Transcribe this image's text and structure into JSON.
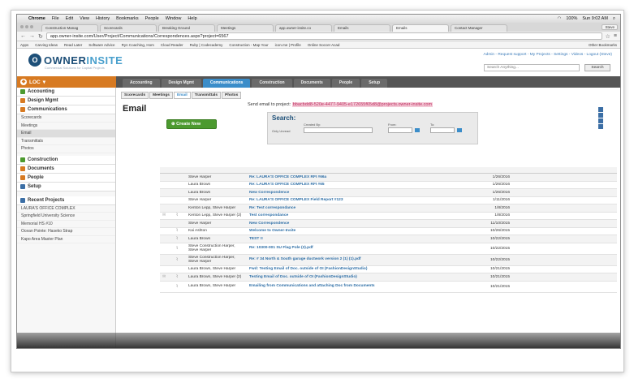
{
  "menubar": {
    "app": "Chrome",
    "items": [
      "File",
      "Edit",
      "View",
      "History",
      "Bookmarks",
      "People",
      "Window",
      "Help"
    ],
    "battery": "100%",
    "clock": "Sun 9:02 AM"
  },
  "tabs": [
    "Construction Manag",
    "Scorecards",
    "Breaking Ground",
    "Meetings",
    "app.owner-insite.co",
    "Emails",
    "Emails",
    "Contact Manager"
  ],
  "browser_user": "Steve",
  "url": "app.owner-insite.com/User/Project/Communications/Correspondences.aspx?project=6567",
  "bookmarks": [
    "Apps",
    "Carving Ideas",
    "Read Later",
    "Software Advice",
    "Ryn Coaching, Hom",
    "Cloud Reader",
    "Ruby | Codecademy",
    "Construction - Map Your",
    "icon.me | Profile",
    "Online Soccer Acad",
    "Other Bookmarks"
  ],
  "logo": {
    "mark": "O",
    "part1": "OWNER",
    "part2": "INSITE",
    "tagline": "Commercial Solutions for Capital Projects"
  },
  "toplinks": "Admin - Request support - My Projects - Settings - Videos - Logout (Steve)",
  "search_placeholder": "Search Anything...",
  "search_button": "Search",
  "loc": "LOC",
  "navtabs": [
    "Accounting",
    "Design Mgmt",
    "Communications",
    "Construction",
    "Documents",
    "People",
    "Setup"
  ],
  "sidebar": {
    "accounting": "Accounting",
    "design": "Design Mgmt",
    "communications": "Communications",
    "comm_items": [
      "Scorecards",
      "Meetings",
      "Email",
      "Transmittals",
      "Photos"
    ],
    "construction": "Construction",
    "documents": "Documents",
    "people": "People",
    "setup": "Setup",
    "recent": "Recent Projects",
    "recent_items": [
      "LAURA'S OFFICE COMPLEX",
      "Springfield University Science",
      "Memorial HS #10",
      "Ocean Pointe: Haseko Strap",
      "Kapo Area Master Plan"
    ]
  },
  "subtabs": [
    "Scorecards",
    "Meetings",
    "Email",
    "Transmittals",
    "Photos"
  ],
  "page_title": "Email",
  "send_email_label": "Send email to project:",
  "send_email_address": "bbacbdd8-520e-4477-9405-e172655f65d8@projects.owner-insite.com",
  "create_button": "Create New",
  "search_panel": {
    "title": "Search:",
    "only_unread": "Only Unread",
    "created_by": "Created By:",
    "from": "From:",
    "to": "To:"
  },
  "rows": [
    {
      "from": "Steve Harper",
      "subject": "Re: LAURA'S OFFICE COMPLEX RFI #66a",
      "date": "1/26/2016",
      "clip": false,
      "mail": false,
      "tall": false
    },
    {
      "from": "Laura Brown",
      "subject": "Re: LAURA'S OFFICE COMPLEX RFI #65",
      "date": "1/26/2016",
      "clip": false,
      "mail": false,
      "tall": false
    },
    {
      "from": "Laura Brown",
      "subject": "New Correspondence",
      "date": "1/26/2016",
      "clip": false,
      "mail": false,
      "tall": false
    },
    {
      "from": "Steve Harper",
      "subject": "Re: LAURA'S OFFICE COMPLEX Field Report #123",
      "date": "1/11/2016",
      "clip": false,
      "mail": false,
      "tall": false
    },
    {
      "from": "Kenton Lepp, Steve Harper",
      "subject": "Re: Test correspondance",
      "date": "1/8/2016",
      "clip": false,
      "mail": false,
      "tall": false
    },
    {
      "from": "Kenton Lepp, Steve Harper (2)",
      "subject": "Test correspondance",
      "date": "1/8/2016",
      "clip": true,
      "mail": true,
      "tall": false
    },
    {
      "from": "Steve Harper",
      "subject": "New Correspondence",
      "date": "11/10/2015",
      "clip": false,
      "mail": false,
      "tall": false
    },
    {
      "from": "Kai Ashton",
      "subject": "Welcome to Owner-Insite",
      "date": "10/26/2015",
      "clip": true,
      "mail": false,
      "tall": false
    },
    {
      "from": "Laura Brown",
      "subject": "TEST !!",
      "date": "10/22/2015",
      "clip": true,
      "mail": false,
      "tall": false
    },
    {
      "from": "Steve Construction Harper, Steve Harper",
      "subject": "Re: 10300-001 SU Flag Pole (2).pdf",
      "date": "10/22/2015",
      "clip": true,
      "mail": false,
      "tall": true
    },
    {
      "from": "Steve Construction Harper, Steve Harper",
      "subject": "Re: # 34 North & South garage ductwork version 2 (1) (1).pdf",
      "date": "10/22/2015",
      "clip": true,
      "mail": false,
      "tall": true
    },
    {
      "from": "Laura Brown, Steve Harper",
      "subject": "Fwd: Testing Email of Doc. outside of OI (FashionDesignStudio)",
      "date": "10/21/2015",
      "clip": false,
      "mail": false,
      "tall": false
    },
    {
      "from": "Laura Brown, Steve Harper (2)",
      "subject": "Testing Email of Doc. outside of OI (FashionDesignStudio)",
      "date": "10/21/2015",
      "clip": true,
      "mail": true,
      "tall": false
    },
    {
      "from": "Laura Brown, Steve Harper",
      "subject": "Emailing from Communications and attaching Doc from Documents",
      "date": "10/21/2015",
      "clip": true,
      "mail": false,
      "tall": true
    }
  ]
}
